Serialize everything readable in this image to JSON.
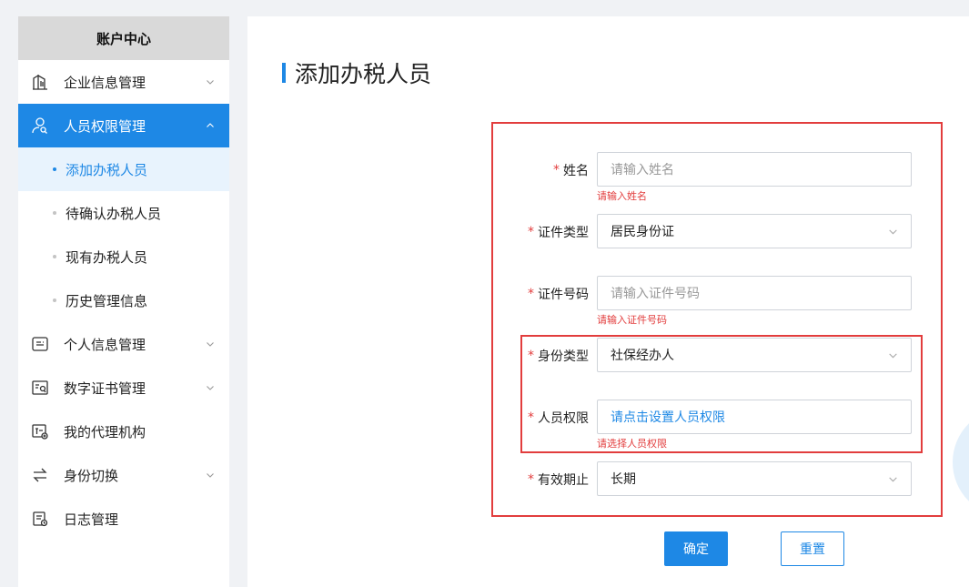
{
  "sidebar": {
    "header": "账户中心",
    "items": [
      {
        "label": "企业信息管理",
        "icon": "building-icon"
      },
      {
        "label": "人员权限管理",
        "icon": "user-search-icon"
      },
      {
        "label": "个人信息管理",
        "icon": "id-card-icon"
      },
      {
        "label": "数字证书管理",
        "icon": "certificate-icon"
      },
      {
        "label": "我的代理机构",
        "icon": "agency-icon"
      },
      {
        "label": "身份切换",
        "icon": "switch-icon"
      },
      {
        "label": "日志管理",
        "icon": "log-icon"
      }
    ],
    "sub_items": [
      {
        "label": "添加办税人员"
      },
      {
        "label": "待确认办税人员"
      },
      {
        "label": "现有办税人员"
      },
      {
        "label": "历史管理信息"
      }
    ]
  },
  "page": {
    "title": "添加办税人员"
  },
  "form": {
    "name": {
      "label": "姓名",
      "placeholder": "请输入姓名",
      "error": "请输入姓名"
    },
    "id_type": {
      "label": "证件类型",
      "value": "居民身份证"
    },
    "id_number": {
      "label": "证件号码",
      "placeholder": "请输入证件号码",
      "error": "请输入证件号码"
    },
    "identity_type": {
      "label": "身份类型",
      "value": "社保经办人"
    },
    "permission": {
      "label": "人员权限",
      "value": "请点击设置人员权限",
      "error": "请选择人员权限"
    },
    "validity": {
      "label": "有效期止",
      "value": "长期"
    },
    "required_mark": "*"
  },
  "buttons": {
    "confirm": "确定",
    "reset": "重置"
  },
  "colors": {
    "accent": "#1e88e5",
    "error": "#e23d3d",
    "highlight_outline": "#e23d3d"
  }
}
